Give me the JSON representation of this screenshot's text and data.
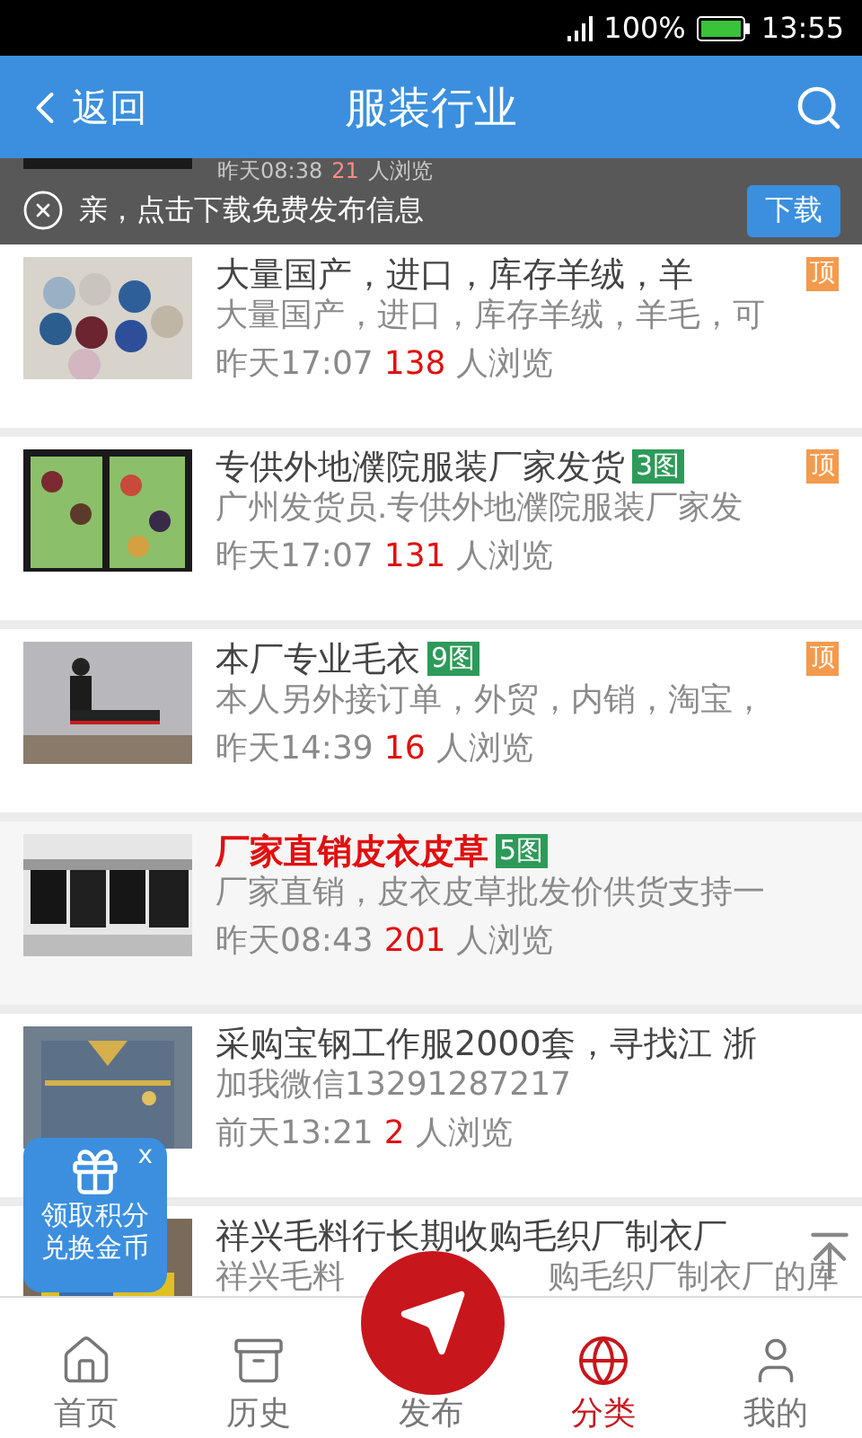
{
  "status_bar": {
    "battery": "100%",
    "time": "13:55"
  },
  "header": {
    "back": "返回",
    "title": "服装行业"
  },
  "partial_item": {
    "time": "昨天08:38",
    "views": "21",
    "views_suffix": "人浏览"
  },
  "banner": {
    "text": "亲，点击下载免费发布信息",
    "button": "下载"
  },
  "items": [
    {
      "title": "大量国产，进口，库存羊绒，羊",
      "top_label": "顶",
      "highlighted": false,
      "description": "大量国产，进口，库存羊绒，羊毛，可",
      "time": "昨天17:07",
      "views": "138",
      "views_suffix": "人浏览"
    },
    {
      "title": "专供外地濮院服装厂家发货",
      "photos": "3图",
      "top_label": "顶",
      "highlighted": false,
      "description": "广州发货员.专供外地濮院服装厂家发",
      "time": "昨天17:07",
      "views": "131",
      "views_suffix": "人浏览"
    },
    {
      "title": "本厂专业毛衣",
      "photos": "9图",
      "top_label": "顶",
      "highlighted": false,
      "description": "本人另外接订单，外贸，内销，淘宝，",
      "time": "昨天14:39",
      "views": "16",
      "views_suffix": "人浏览"
    },
    {
      "title": "厂家直销皮衣皮草",
      "photos": "5图",
      "highlighted": true,
      "description": "厂家直销，皮衣皮草批发价供货支持一",
      "time": "昨天08:43",
      "views": "201",
      "views_suffix": "人浏览"
    },
    {
      "title": "采购宝钢工作服2000套，寻找江 浙",
      "highlighted": false,
      "description": "加我微信13291287217",
      "time": "前天13:21",
      "views": "2",
      "views_suffix": "人浏览"
    },
    {
      "title": "祥兴毛料行长期收购毛织厂制衣厂",
      "highlighted": false,
      "description_parts": [
        "祥兴毛料",
        "购毛织厂制衣厂的库"
      ]
    }
  ],
  "gift_widget": {
    "close": "x",
    "lines": [
      "领取积分",
      "兑换金币"
    ]
  },
  "nav": [
    {
      "kind": "home",
      "label": "首页",
      "selected": false
    },
    {
      "kind": "history",
      "label": "历史",
      "selected": false
    },
    {
      "kind": "publish",
      "label": "发布",
      "selected": false
    },
    {
      "kind": "category",
      "label": "分类",
      "selected": true
    },
    {
      "kind": "mine",
      "label": "我的",
      "selected": false
    }
  ]
}
